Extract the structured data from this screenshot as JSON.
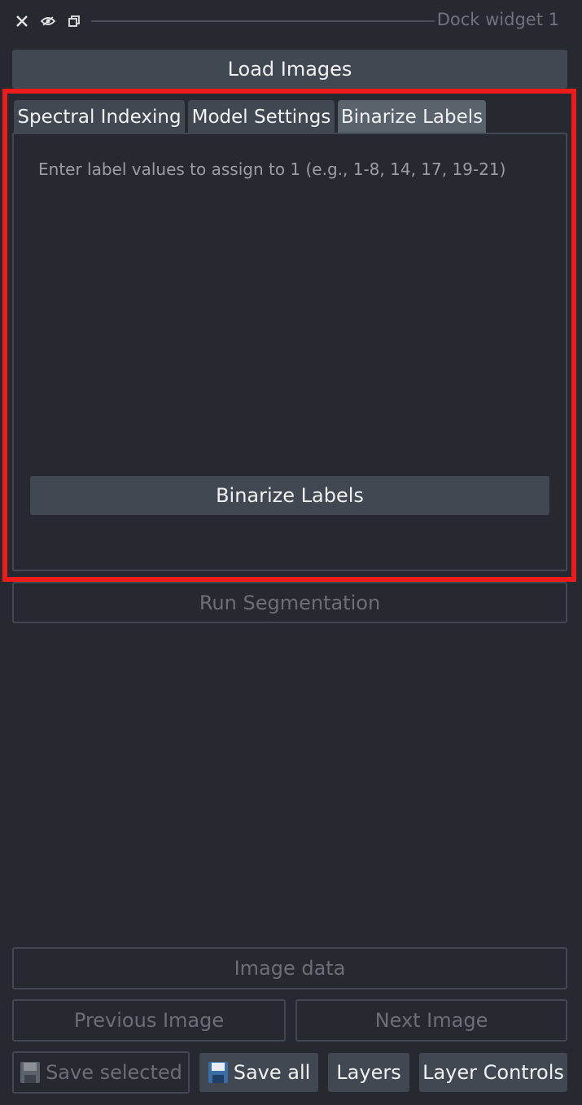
{
  "window": {
    "title": "Dock widget 1",
    "close_icon": "close-icon",
    "float_icon": "eye-icon",
    "restore_icon": "restore-icon"
  },
  "buttons": {
    "load_images": "Load Images",
    "run_segmentation": "Run Segmentation",
    "image_data": "Image data",
    "previous_image": "Previous Image",
    "next_image": "Next Image",
    "save_selected": "Save selected",
    "save_all": "Save all",
    "layers": "Layers",
    "layer_controls": "Layer Controls"
  },
  "tabs": [
    {
      "label": "Spectral Indexing",
      "active": false
    },
    {
      "label": "Model Settings",
      "active": false
    },
    {
      "label": "Binarize Labels",
      "active": true
    }
  ],
  "binarize_pane": {
    "instruction": "Enter label values to assign to 1 (e.g., 1-8, 14, 17, 19-21)",
    "button_label": "Binarize Labels"
  },
  "colors": {
    "background": "#262930",
    "button": "#414851",
    "active_tab": "#5a626c",
    "highlight": "#ee1b1b",
    "floppy_icon": "#3a6ea5"
  }
}
